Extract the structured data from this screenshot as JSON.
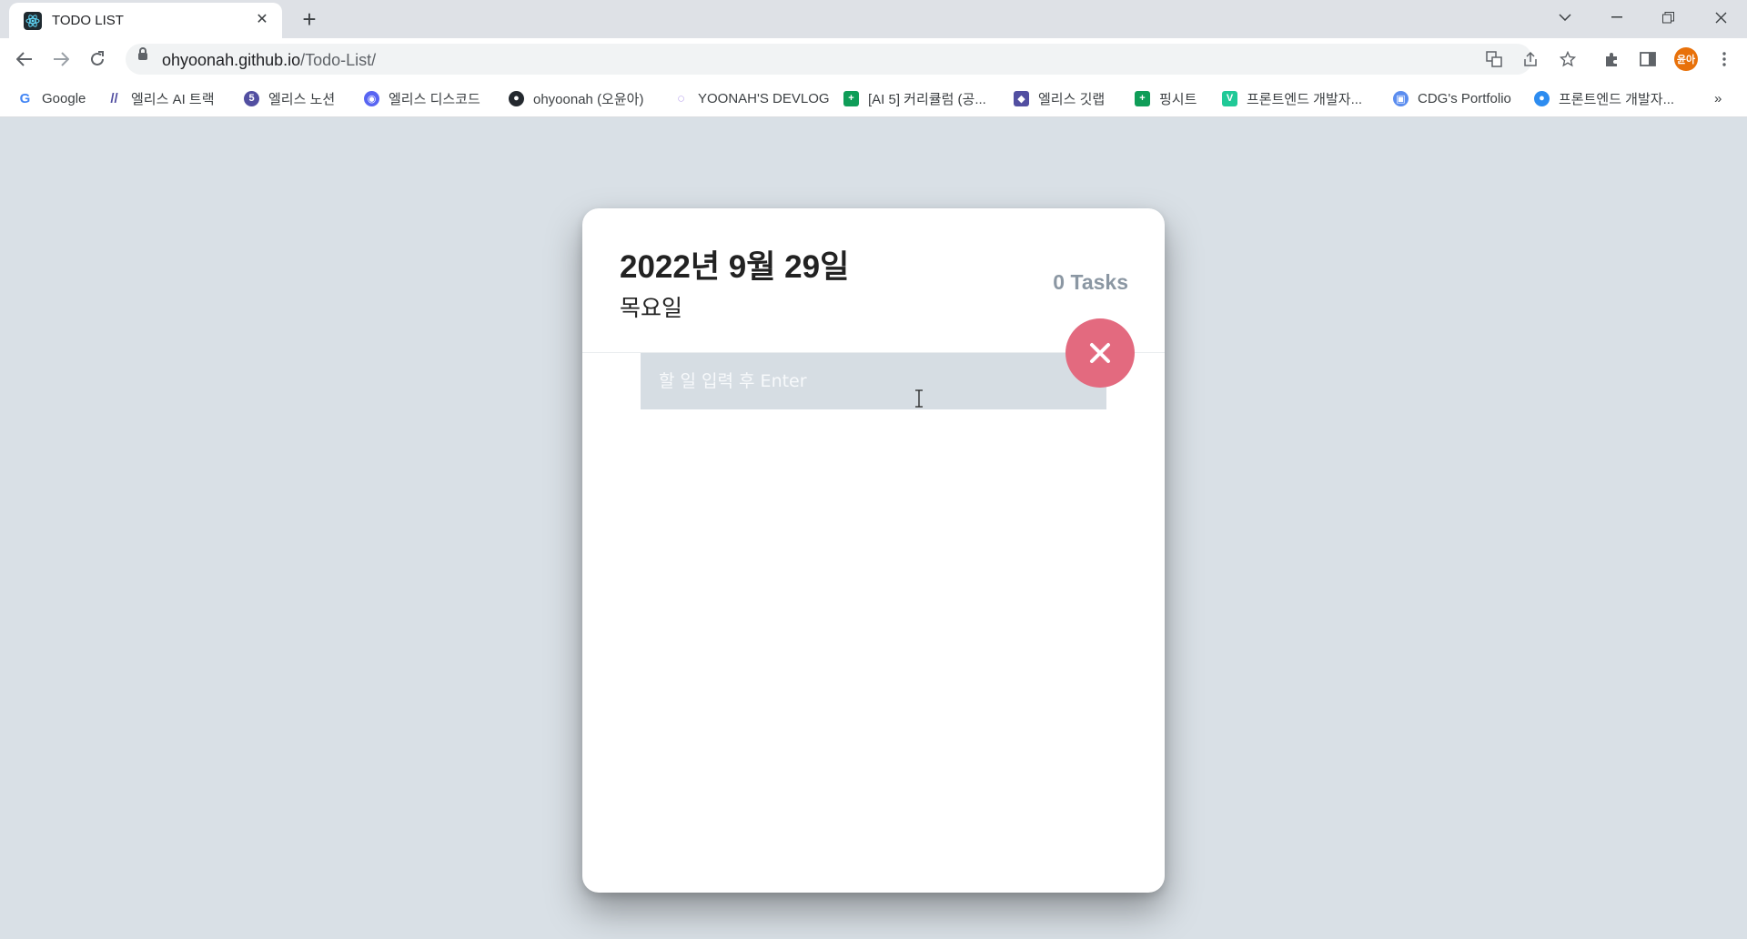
{
  "browser": {
    "tab_title": "TODO LIST",
    "tab_close": "✕",
    "new_tab": "+",
    "url_host": "ohyoonah.github.io",
    "url_path": "/Todo-List/",
    "profile_initials": "윤아",
    "bookmarks": [
      {
        "label": "Google",
        "icon": "google-icon",
        "color": "#4285f4"
      },
      {
        "label": "엘리스 AI 트랙",
        "icon": "slash-icon",
        "color": "#524fa1"
      },
      {
        "label": "엘리스 노션",
        "icon": "notion-icon",
        "color": "#524fa1"
      },
      {
        "label": "엘리스 디스코드",
        "icon": "discord-icon",
        "color": "#5865f2"
      },
      {
        "label": "ohyoonah (오윤아)",
        "icon": "github-icon",
        "color": "#24292f"
      },
      {
        "label": "YOONAH'S DEVLOG",
        "icon": "loading-icon",
        "color": "#c5b3f0"
      },
      {
        "label": "[AI 5] 커리큘럼 (공...",
        "icon": "sheets-icon",
        "color": "#0f9d58"
      },
      {
        "label": "엘리스 깃랩",
        "icon": "gitlab-icon",
        "color": "#524fa1"
      },
      {
        "label": "핑시트",
        "icon": "sheets-icon",
        "color": "#0f9d58"
      },
      {
        "label": "프론트엔드 개발자...",
        "icon": "velog-icon",
        "color": "#20c997"
      },
      {
        "label": "CDG's Portfolio",
        "icon": "portfolio-icon",
        "color": "#5b8def"
      },
      {
        "label": "프론트엔드 개발자...",
        "icon": "page-icon",
        "color": "#2d8cf0"
      }
    ],
    "more_bookmarks": "»"
  },
  "app": {
    "date": "2022년 9월 29일",
    "weekday": "목요일",
    "tasks": "0 Tasks",
    "input_placeholder": "할 일 입력 후 Enter",
    "accent_color": "#e36a7f"
  }
}
